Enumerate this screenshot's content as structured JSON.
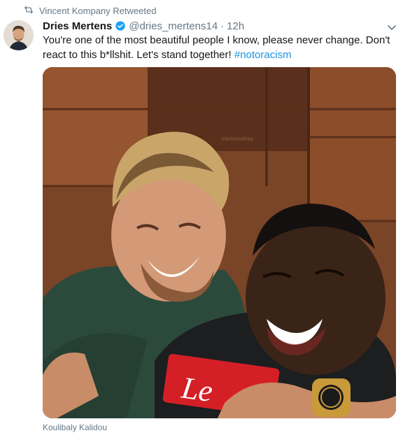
{
  "retweet": {
    "icon": "retweet-icon",
    "text": "Vincent Kompany Retweeted"
  },
  "tweet": {
    "author_name": "Dries Mertens",
    "verified_icon": "verified-badge-icon",
    "handle": "@dries_mertens14",
    "separator": "·",
    "timestamp": "12h",
    "text_before_hashtag": "You're one of the most beautiful people I know, please never change. Don't react to this b*llshit. Let's stand together! ",
    "hashtag": "#notoracism",
    "media": {
      "watermark": "mertensdries",
      "jersey_sponsor": "Le",
      "caption": "Koulibaly Kalidou"
    }
  },
  "colors": {
    "link": "#1b95e0",
    "secondary_text": "#657786",
    "verified": "#1da1f2"
  }
}
